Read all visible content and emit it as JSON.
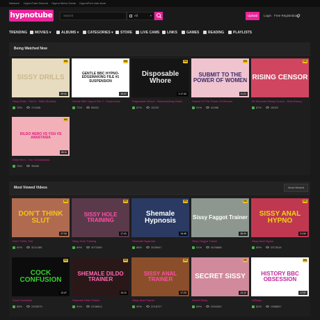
{
  "network": {
    "label": "Network:",
    "links": [
      "HypnoTube Discord",
      "Hypno Metro Game",
      "HypnoFem club store"
    ]
  },
  "header": {
    "logo": "hypnotube",
    "search_placeholder": "Search",
    "search_scope": "All",
    "upload_label": "Upload",
    "login_label": "Login",
    "register_label": "Free Registration"
  },
  "nav": {
    "items": [
      "TRENDING",
      "MOVIES",
      "ALBUMS",
      "CATEGORIES",
      "STORE",
      "LIVE CAMS",
      "LINKS",
      "GAMES",
      "READING",
      "PLAYLISTS"
    ]
  },
  "being_watched": {
    "title": "Being Watched Now",
    "cards": [
      {
        "thumb_text": "SISSY DRILLS",
        "duration": "29:41",
        "title": "Sissy Drills - Part 6 - Slide (Submit)",
        "rating": "76%",
        "views": "174186",
        "bg": "#e7dcc0",
        "fg": "#c9b98c"
      },
      {
        "thumb_text": "GENTLE BBC HYPNO-EDGEMAKING FILE #1 SUSPENSION",
        "duration": "19:47",
        "title": "Gentle BBC Hypno File 4 - Suspension",
        "rating": "72%",
        "views": "85631",
        "bg": "#ffffff",
        "fg": "#222222"
      },
      {
        "thumb_text": "Disposable Whore",
        "duration": "1:17:44",
        "title": "Disposable Whore - Brainwashing Medit...",
        "rating": "87%",
        "views": "15223",
        "bg": "#151515",
        "fg": "#eeeeee"
      },
      {
        "thumb_text": "SUBMIT TO THE POWER OF WOMEN",
        "duration": "11:21",
        "title": "Submit To The Power Of Women",
        "rating": "91%",
        "views": "42486",
        "bg": "#f0c4cf",
        "fg": "#3a2b6a"
      },
      {
        "thumb_text": "RISING CENSOR",
        "duration": "",
        "title": "90 Seconds Rising Censor - Blue Bunny...",
        "rating": "87%",
        "views": "18022",
        "bg": "#d04560",
        "fg": "#ffffff"
      },
      {
        "thumb_text": "DILDO HERO VS YOU VS ANASTASIA",
        "duration": "28:11",
        "title": "Dildo Hero - You Vs Anastasia",
        "rating": "76%",
        "views": "35606",
        "bg": "#f2b0b9",
        "fg": "#e0147a"
      }
    ]
  },
  "most_viewed": {
    "title": "Most Viewed Videos",
    "button_label": "Most Viewed",
    "cards": [
      {
        "thumb_text": "DON'T THINK SLUT",
        "duration": "27:34",
        "title": "Don't Think, Slut",
        "rating": "92%",
        "views": "3211385",
        "bg": "#b06a50",
        "fg": "#f2c21a"
      },
      {
        "thumb_text": "SISSY HOLE TRAINING",
        "duration": "17:41",
        "title": "Sissy Hole Training",
        "rating": "89%",
        "views": "3073389",
        "bg": "#5a3a4a",
        "fg": "#ff4fa8"
      },
      {
        "thumb_text": "Shemale Hypnosis",
        "duration": "19:45",
        "title": "Shemale Hypnosis",
        "rating": "88%",
        "views": "3038947",
        "bg": "#2a3a62",
        "fg": "#ffffff"
      },
      {
        "thumb_text": "Sissy Faggot Trainer",
        "duration": "38:09",
        "title": "Sissy Faggot Trainer",
        "rating": "91%",
        "views": "3026888",
        "bg": "#8e9690",
        "fg": "#ffffff"
      },
      {
        "thumb_text": "SISSY ANAL HYPNO",
        "duration": "21:54",
        "title": "Sissy Anal Hypno",
        "rating": "89%",
        "views": "2573016",
        "bg": "#c0384f",
        "fg": "#f2d21a"
      },
      {
        "thumb_text": "COCK CONFUSION",
        "duration": "12:47",
        "title": "Cock Confusion",
        "rating": "88%",
        "views": "2263979",
        "bg": "#0c0c0c",
        "fg": "#35d12d"
      },
      {
        "thumb_text": "SHEMALE DILDO TRAINER",
        "duration": "24:11",
        "title": "Shemale Dildo Trainer",
        "rating": "91%",
        "views": "2246814",
        "bg": "#2a1818",
        "fg": "#ff6bb5"
      },
      {
        "thumb_text": "SISSY ANAL TRAINER",
        "duration": "17:23",
        "title": "Sissy Anal Trainer",
        "rating": "90%",
        "views": "2218727",
        "bg": "#8a4e2a",
        "fg": "#ff4fa8"
      },
      {
        "thumb_text": "SECRET SISSY",
        "duration": "13:12",
        "title": "Secret Sissy",
        "rating": "89%",
        "views": "2094392",
        "bg": "#d08a9c",
        "fg": "#ffffff"
      },
      {
        "thumb_text": "HISTORY BBC OBSESSION",
        "duration": "17:57",
        "title": "HISissy...",
        "rating": "82%",
        "views": "1988837",
        "bg": "#ffffff",
        "fg": "#c02a9a"
      }
    ]
  },
  "icons": {
    "up": "thumbs-up-icon",
    "views": "eye-icon",
    "hd": "hd-badge"
  },
  "colors": {
    "accent": "#e8259a",
    "background": "#1a1a1a",
    "panel": "#1e1e1e",
    "hd_badge": "#f2c21a",
    "rating": "#4caf50"
  }
}
